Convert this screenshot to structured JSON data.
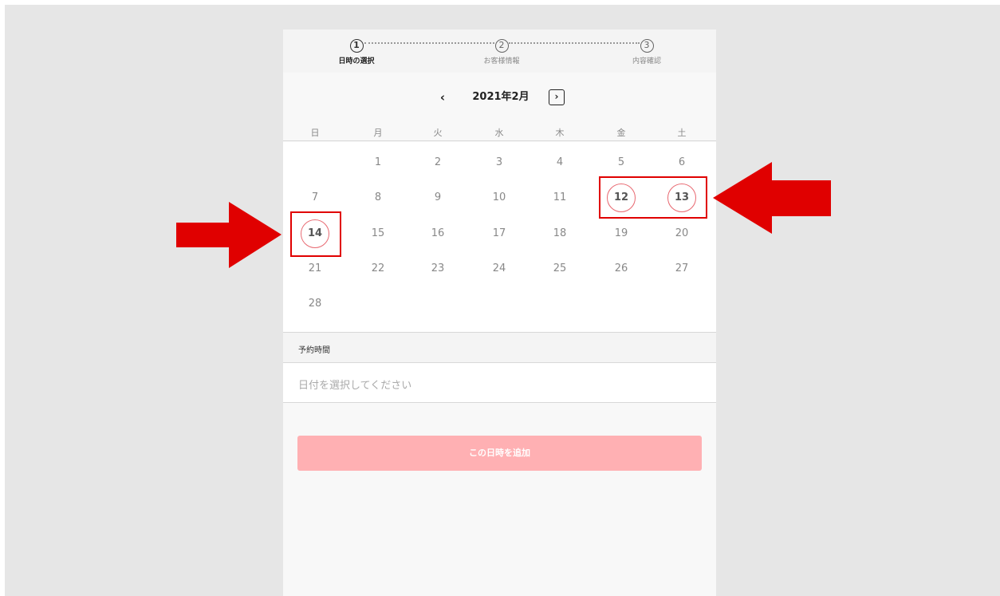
{
  "steps": [
    {
      "num": "1",
      "label": "日時の選択"
    },
    {
      "num": "2",
      "label": "お客様情報"
    },
    {
      "num": "3",
      "label": "内容確認"
    }
  ],
  "calendar": {
    "prev_icon": "‹",
    "next_icon": "›",
    "month_title": "2021年2月",
    "weekdays": [
      "日",
      "月",
      "火",
      "水",
      "木",
      "金",
      "土"
    ],
    "weeks": [
      [
        "",
        "1",
        "2",
        "3",
        "4",
        "5",
        "6"
      ],
      [
        "7",
        "8",
        "9",
        "10",
        "11",
        "12",
        "13"
      ],
      [
        "14",
        "15",
        "16",
        "17",
        "18",
        "19",
        "20"
      ],
      [
        "21",
        "22",
        "23",
        "24",
        "25",
        "26",
        "27"
      ],
      [
        "28",
        "",
        "",
        "",
        "",
        "",
        ""
      ]
    ],
    "available_days": [
      "12",
      "13",
      "14"
    ]
  },
  "time": {
    "label": "予約時間",
    "placeholder": "日付を選択してください"
  },
  "add_button": {
    "label": "この日時を追加"
  },
  "colors": {
    "accent": "#e86a72",
    "button_disabled": "#ffb0b3",
    "annotation": "#e00000"
  },
  "icons": {
    "prev": "chevron-left-icon",
    "next": "chevron-right-icon",
    "annotation_arrows": [
      "arrow-right-icon",
      "arrow-left-icon"
    ]
  }
}
